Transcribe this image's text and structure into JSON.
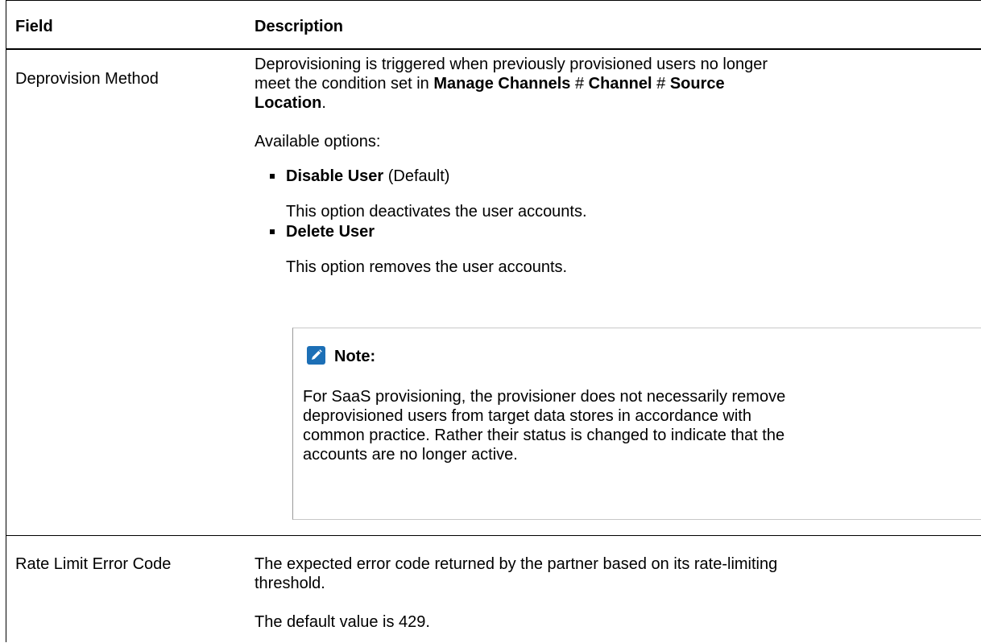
{
  "table": {
    "headers": {
      "field": "Field",
      "description": "Description"
    },
    "rows": [
      {
        "field": "Deprovision Method",
        "intro_line1": "Deprovisioning is triggered when previously provisioned users no longer",
        "intro_line2_prefix": "meet the condition set in ",
        "intro_bold_1": "Manage Channels",
        "separator_1": " # ",
        "intro_bold_2": "Channel",
        "separator_2": " # ",
        "intro_bold_3": "Source",
        "intro_line3_bold": "Location",
        "intro_line3_suffix": ".",
        "options_label": "Available options:",
        "options": [
          {
            "name": "Disable User",
            "suffix": " (Default)",
            "description": "This option deactivates the user accounts."
          },
          {
            "name": "Delete User",
            "suffix": "",
            "description": "This option removes the user accounts."
          }
        ],
        "note": {
          "title": "Note:",
          "lines": [
            "For SaaS provisioning, the provisioner does not necessarily remove",
            "deprovisioned users from target data stores in accordance with",
            "common practice. Rather their status is changed to indicate that the",
            "accounts are no longer active."
          ]
        }
      },
      {
        "field": "Rate Limit Error Code",
        "lines": [
          "The expected error code returned by the partner based on its rate-limiting",
          "threshold."
        ],
        "default_text": "The default value is 429."
      }
    ]
  },
  "colors": {
    "note_icon": "#1c6fb6"
  },
  "icons": {
    "note": "pencil-note-icon"
  }
}
